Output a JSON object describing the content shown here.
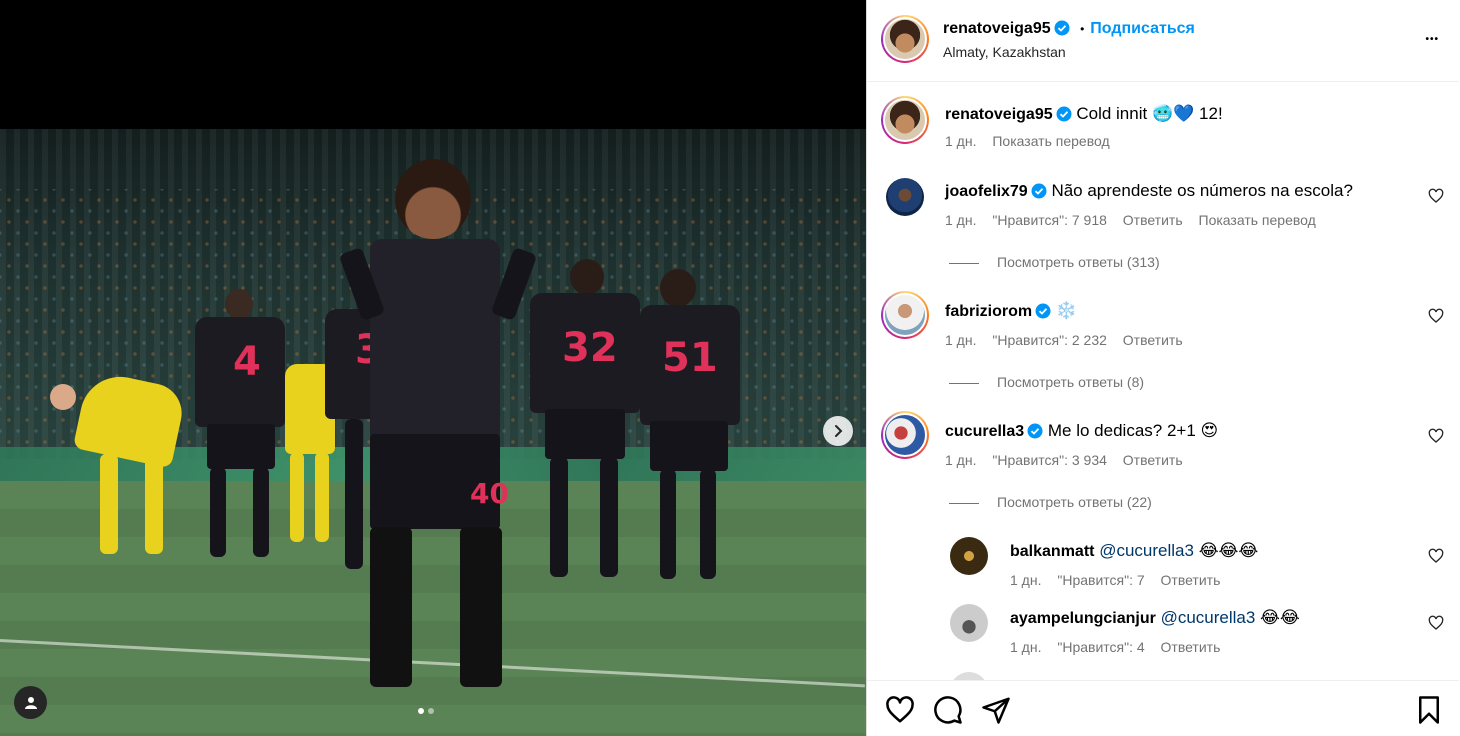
{
  "post": {
    "username": "renatoveiga95",
    "separator": "•",
    "follow_label": "Подписаться",
    "location": "Almaty, Kazakhstan",
    "more_label": "•••"
  },
  "caption": {
    "username": "renatoveiga95",
    "text": "Cold innit",
    "emojis": "🥶💙",
    "tail": "12!",
    "time": "1 дн.",
    "translate": "Показать перевод"
  },
  "comments": [
    {
      "username": "joaofelix79",
      "text": "Não aprendeste os números na escola?",
      "time": "1 дн.",
      "likes": "\"Нравится\": 7 918",
      "reply": "Ответить",
      "translate": "Показать перевод",
      "view_replies": "Посмотреть ответы (313)"
    },
    {
      "username": "fabriziorom",
      "text": "❄️",
      "time": "1 дн.",
      "likes": "\"Нравится\": 2 232",
      "reply": "Ответить",
      "view_replies": "Посмотреть ответы (8)"
    },
    {
      "username": "cucurella3",
      "text": "Me lo dedicas? 2+1",
      "emoji": "😍",
      "time": "1 дн.",
      "likes": "\"Нравится\": 3 934",
      "reply": "Ответить",
      "view_replies": "Посмотреть ответы (22)"
    }
  ],
  "replies": [
    {
      "username": "balkanmatt",
      "mention": "@cucurella3",
      "emoji": "😂😂😂",
      "time": "1 дн.",
      "likes": "\"Нравится\": 7",
      "reply": "Ответить"
    },
    {
      "username": "ayampelungcianjur",
      "mention": "@cucurella3",
      "emoji": "😂😂",
      "time": "1 дн.",
      "likes": "\"Нравится\": 4",
      "reply": "Ответить"
    }
  ],
  "photo": {
    "numbers": [
      "4",
      "32",
      "51",
      "40",
      "3"
    ]
  },
  "colors": {
    "accent": "#0095f6",
    "verified": "#0095f6",
    "meta": "#737373"
  },
  "icons": [
    "heart-icon",
    "comment-icon",
    "share-icon",
    "bookmark-icon",
    "chevron-right-icon",
    "user-tag-icon",
    "verified-icon",
    "more-icon"
  ]
}
